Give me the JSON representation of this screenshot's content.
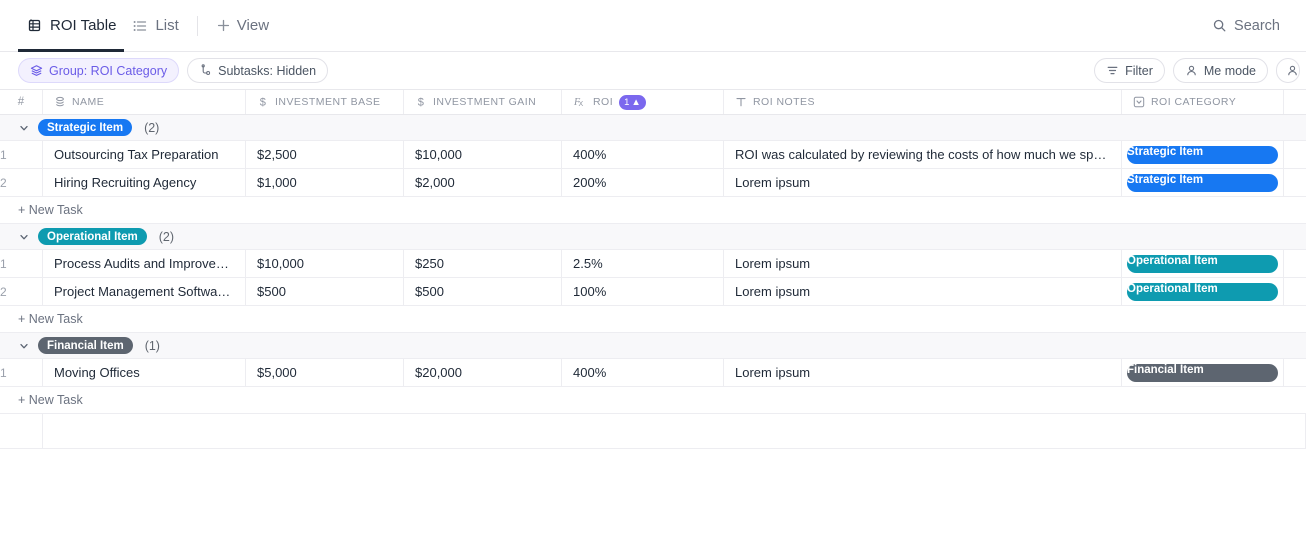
{
  "topbar": {
    "tabs": [
      {
        "label": "ROI Table",
        "icon": "table-icon",
        "active": true
      },
      {
        "label": "List",
        "icon": "list-icon",
        "active": false
      }
    ],
    "add_view_label": "View",
    "add_view_icon": "plus-icon",
    "search_label": "Search",
    "search_icon": "search-icon"
  },
  "toolbar": {
    "left_chips": [
      {
        "label": "Group: ROI Category",
        "icon": "layers-icon",
        "accent": true
      },
      {
        "label": "Subtasks: Hidden",
        "icon": "subtask-icon",
        "accent": false
      }
    ],
    "right_chips": [
      {
        "label": "Filter",
        "icon": "filter-icon"
      },
      {
        "label": "Me mode",
        "icon": "person-icon"
      }
    ],
    "clipped_chip_icon": "person-icon"
  },
  "table": {
    "columns": [
      {
        "key": "index",
        "label": "#",
        "icon": ""
      },
      {
        "key": "name",
        "label": "Name",
        "icon": "name-icon"
      },
      {
        "key": "investment_base",
        "label": "Investment Base",
        "icon": "dollar-icon"
      },
      {
        "key": "investment_gain",
        "label": "Investment Gain",
        "icon": "dollar-icon"
      },
      {
        "key": "roi",
        "label": "ROI",
        "icon": "formula-icon",
        "sort_badge": "1",
        "sort_dir": "▲"
      },
      {
        "key": "roi_notes",
        "label": "ROI Notes",
        "icon": "text-icon"
      },
      {
        "key": "roi_category",
        "label": "ROI Category",
        "icon": "dropdown-icon"
      }
    ],
    "new_task_label": "+ New Task",
    "groups": [
      {
        "name": "Strategic Item",
        "count": "(2)",
        "color": "#1778f2",
        "caret": "⌄",
        "rows": [
          {
            "index": "1",
            "name": "Outsourcing Tax Preparation",
            "investment_base": "$2,500",
            "investment_gain": "$10,000",
            "roi": "400%",
            "roi_notes": "ROI was calculated by reviewing the costs of how much we sp…",
            "roi_category": "Strategic Item"
          },
          {
            "index": "2",
            "name": "Hiring Recruiting Agency",
            "investment_base": "$1,000",
            "investment_gain": "$2,000",
            "roi": "200%",
            "roi_notes": "Lorem ipsum",
            "roi_category": "Strategic Item"
          }
        ]
      },
      {
        "name": "Operational Item",
        "count": "(2)",
        "color": "#0e9bb0",
        "caret": "⌄",
        "rows": [
          {
            "index": "1",
            "name": "Process Audits and Improve…",
            "investment_base": "$10,000",
            "investment_gain": "$250",
            "roi": "2.5%",
            "roi_notes": "Lorem ipsum",
            "roi_category": "Operational Item"
          },
          {
            "index": "2",
            "name": "Project Management Softwa…",
            "investment_base": "$500",
            "investment_gain": "$500",
            "roi": "100%",
            "roi_notes": "Lorem ipsum",
            "roi_category": "Operational Item"
          }
        ]
      },
      {
        "name": "Financial Item",
        "count": "(1)",
        "color": "#5d6570",
        "caret": "⌄",
        "rows": [
          {
            "index": "1",
            "name": "Moving Offices",
            "investment_base": "$5,000",
            "investment_gain": "$20,000",
            "roi": "400%",
            "roi_notes": "Lorem ipsum",
            "roi_category": "Financial Item"
          }
        ]
      }
    ]
  }
}
